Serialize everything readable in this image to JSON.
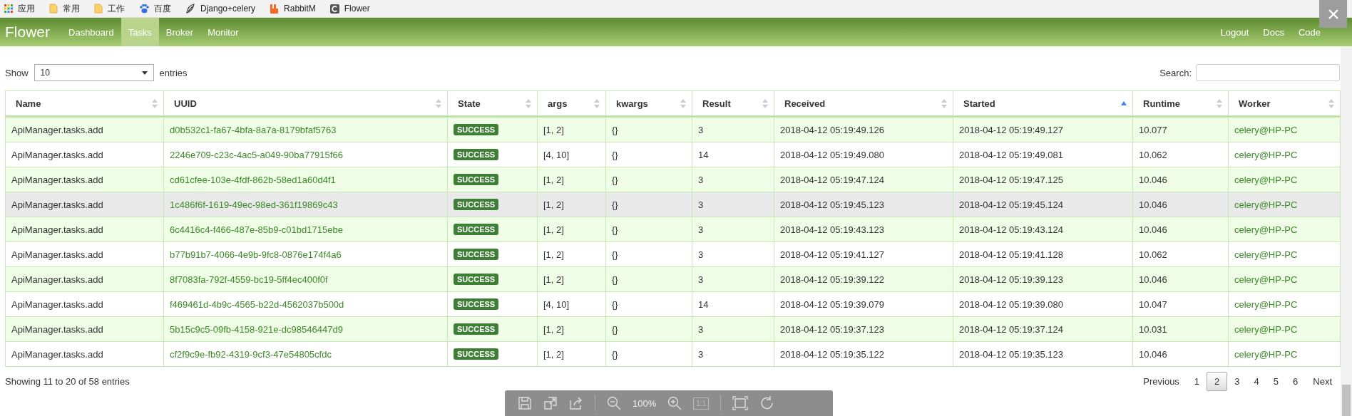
{
  "bookmarks": [
    {
      "label": "应用"
    },
    {
      "label": "常用"
    },
    {
      "label": "工作"
    },
    {
      "label": "百度"
    },
    {
      "label": "Django+celery"
    },
    {
      "label": "RabbitM"
    },
    {
      "label": "Flower"
    }
  ],
  "navbar": {
    "brand": "Flower",
    "items": [
      {
        "label": "Dashboard",
        "selected": false
      },
      {
        "label": "Tasks",
        "selected": true
      },
      {
        "label": "Broker",
        "selected": false
      },
      {
        "label": "Monitor",
        "selected": false
      }
    ],
    "right_items": [
      "Logout",
      "Docs",
      "Code"
    ]
  },
  "controls": {
    "show_label": "Show",
    "page_size": "10",
    "entries_label": "entries",
    "search_label": "Search:"
  },
  "table": {
    "columns": [
      {
        "label": "Name",
        "sorted": false
      },
      {
        "label": "UUID",
        "sorted": false
      },
      {
        "label": "State",
        "sorted": false
      },
      {
        "label": "args",
        "sorted": false
      },
      {
        "label": "kwargs",
        "sorted": false
      },
      {
        "label": "Result",
        "sorted": false
      },
      {
        "label": "Received",
        "sorted": false
      },
      {
        "label": "Started",
        "sorted": true
      },
      {
        "label": "Runtime",
        "sorted": false
      },
      {
        "label": "Worker",
        "sorted": false
      }
    ],
    "rows": [
      {
        "name": "ApiManager.tasks.add",
        "uuid": "d0b532c1-fa67-4bfa-8a7a-8179bfaf5763",
        "state": "SUCCESS",
        "args": "[1, 2]",
        "kwargs": "{}",
        "result": "3",
        "received": "2018-04-12 05:19:49.126",
        "started": "2018-04-12 05:19:49.127",
        "runtime": "10.077",
        "worker": "celery@HP-PC",
        "hovered": false
      },
      {
        "name": "ApiManager.tasks.add",
        "uuid": "2246e709-c23c-4ac5-a049-90ba77915f66",
        "state": "SUCCESS",
        "args": "[4, 10]",
        "kwargs": "{}",
        "result": "14",
        "received": "2018-04-12 05:19:49.080",
        "started": "2018-04-12 05:19:49.081",
        "runtime": "10.062",
        "worker": "celery@HP-PC",
        "hovered": false
      },
      {
        "name": "ApiManager.tasks.add",
        "uuid": "cd61cfee-103e-4fdf-862b-58ed1a60d4f1",
        "state": "SUCCESS",
        "args": "[1, 2]",
        "kwargs": "{}",
        "result": "3",
        "received": "2018-04-12 05:19:47.124",
        "started": "2018-04-12 05:19:47.125",
        "runtime": "10.046",
        "worker": "celery@HP-PC",
        "hovered": false
      },
      {
        "name": "ApiManager.tasks.add",
        "uuid": "1c486f6f-1619-49ec-98ed-361f19869c43",
        "state": "SUCCESS",
        "args": "[1, 2]",
        "kwargs": "{}",
        "result": "3",
        "received": "2018-04-12 05:19:45.123",
        "started": "2018-04-12 05:19:45.124",
        "runtime": "10.046",
        "worker": "celery@HP-PC",
        "hovered": true
      },
      {
        "name": "ApiManager.tasks.add",
        "uuid": "6c4416c4-f466-487e-85b9-c01bd1715ebe",
        "state": "SUCCESS",
        "args": "[1, 2]",
        "kwargs": "{}",
        "result": "3",
        "received": "2018-04-12 05:19:43.123",
        "started": "2018-04-12 05:19:43.124",
        "runtime": "10.046",
        "worker": "celery@HP-PC",
        "hovered": false
      },
      {
        "name": "ApiManager.tasks.add",
        "uuid": "b77b91b7-4066-4e9b-9fc8-0876e174f4a6",
        "state": "SUCCESS",
        "args": "[1, 2]",
        "kwargs": "{}",
        "result": "3",
        "received": "2018-04-12 05:19:41.127",
        "started": "2018-04-12 05:19:41.128",
        "runtime": "10.062",
        "worker": "celery@HP-PC",
        "hovered": false
      },
      {
        "name": "ApiManager.tasks.add",
        "uuid": "8f7083fa-792f-4559-bc19-5ff4ec400f0f",
        "state": "SUCCESS",
        "args": "[1, 2]",
        "kwargs": "{}",
        "result": "3",
        "received": "2018-04-12 05:19:39.122",
        "started": "2018-04-12 05:19:39.123",
        "runtime": "10.046",
        "worker": "celery@HP-PC",
        "hovered": false
      },
      {
        "name": "ApiManager.tasks.add",
        "uuid": "f469461d-4b9c-4565-b22d-4562037b500d",
        "state": "SUCCESS",
        "args": "[4, 10]",
        "kwargs": "{}",
        "result": "14",
        "received": "2018-04-12 05:19:39.079",
        "started": "2018-04-12 05:19:39.080",
        "runtime": "10.047",
        "worker": "celery@HP-PC",
        "hovered": false
      },
      {
        "name": "ApiManager.tasks.add",
        "uuid": "5b15c9c5-09fb-4158-921e-dc98546447d9",
        "state": "SUCCESS",
        "args": "[1, 2]",
        "kwargs": "{}",
        "result": "3",
        "received": "2018-04-12 05:19:37.123",
        "started": "2018-04-12 05:19:37.124",
        "runtime": "10.031",
        "worker": "celery@HP-PC",
        "hovered": false
      },
      {
        "name": "ApiManager.tasks.add",
        "uuid": "cf2f9c9e-fb92-4319-9cf3-47e54805cfdc",
        "state": "SUCCESS",
        "args": "[1, 2]",
        "kwargs": "{}",
        "result": "3",
        "received": "2018-04-12 05:19:35.122",
        "started": "2018-04-12 05:19:35.123",
        "runtime": "10.046",
        "worker": "celery@HP-PC",
        "hovered": false
      }
    ]
  },
  "footer": {
    "info": "Showing 11 to 20 of 58 entries",
    "previous": "Previous",
    "pages": [
      {
        "label": "1",
        "selected": false
      },
      {
        "label": "2",
        "selected": true
      },
      {
        "label": "3",
        "selected": false
      },
      {
        "label": "4",
        "selected": false
      },
      {
        "label": "5",
        "selected": false
      },
      {
        "label": "6",
        "selected": false
      }
    ],
    "next": "Next"
  },
  "viewer_toolbar": {
    "zoom": "100%",
    "actual_size": "1:1"
  }
}
